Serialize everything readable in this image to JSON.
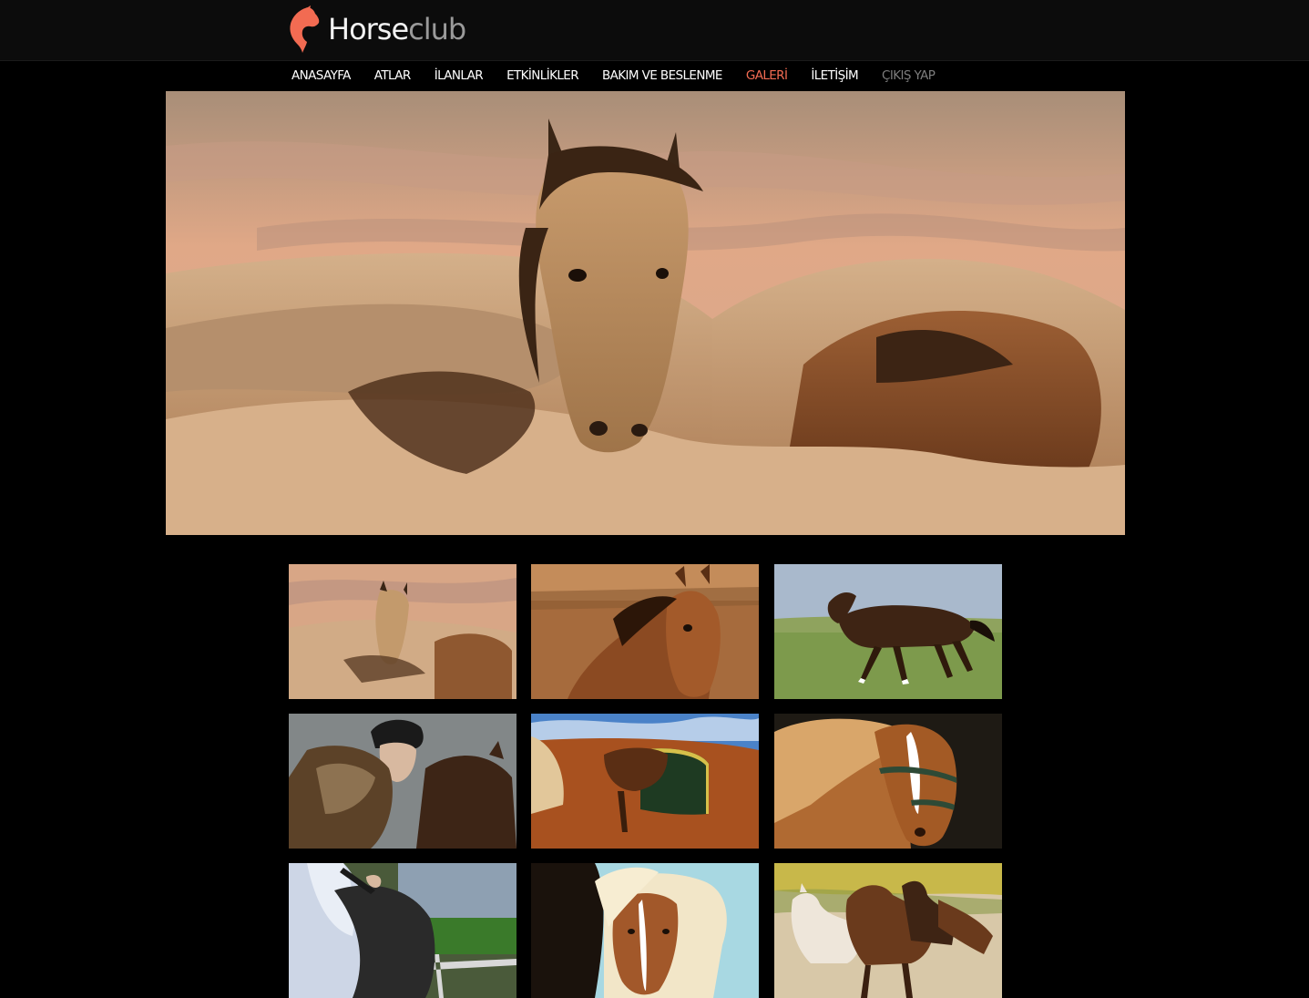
{
  "brand": {
    "name_part1": "Horse",
    "name_part2": "club",
    "accent_color": "#f26b52"
  },
  "nav": {
    "items": [
      {
        "label": "ANASAYFA",
        "state": "normal"
      },
      {
        "label": "ATLAR",
        "state": "normal"
      },
      {
        "label": "İLANLAR",
        "state": "normal"
      },
      {
        "label": "ETKİNLİKLER",
        "state": "normal"
      },
      {
        "label": "BAKIM VE BESLENME",
        "state": "normal"
      },
      {
        "label": "GALERİ",
        "state": "active"
      },
      {
        "label": "İLETİŞİM",
        "state": "normal"
      },
      {
        "label": "ÇIKIŞ YAP",
        "state": "muted"
      }
    ]
  },
  "hero": {
    "icon": "horse-herd-sunset-image"
  },
  "gallery": {
    "thumbnails": [
      {
        "icon": "horse-herd-sunset-thumb"
      },
      {
        "icon": "bay-horse-portrait-thumb"
      },
      {
        "icon": "galloping-horse-field-thumb"
      },
      {
        "icon": "rider-with-helmet-thumb"
      },
      {
        "icon": "saddled-horse-thumb"
      },
      {
        "icon": "chestnut-horse-halter-thumb"
      },
      {
        "icon": "rider-legs-thumb"
      },
      {
        "icon": "blonde-mane-ponies-thumb"
      },
      {
        "icon": "running-horses-dust-thumb"
      }
    ]
  }
}
